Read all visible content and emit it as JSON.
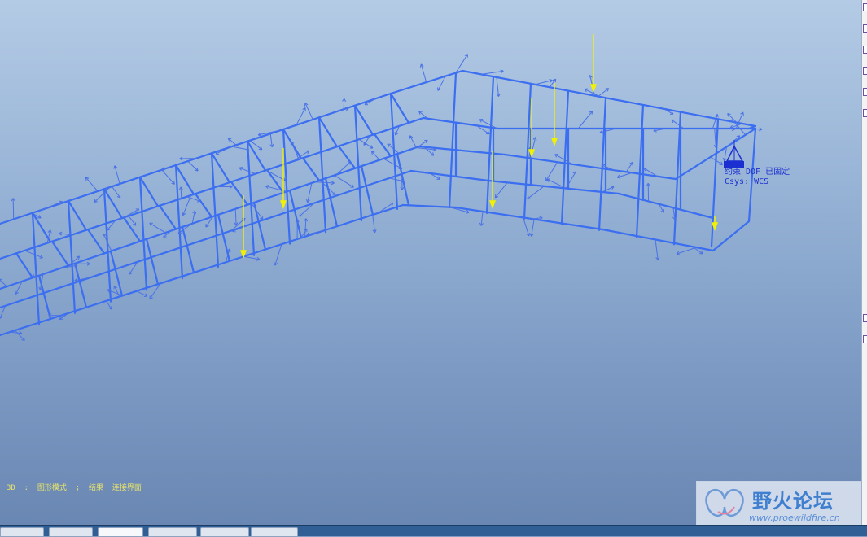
{
  "viewport": {
    "background_top": "#b4cbe5",
    "background_bottom": "#6a87b3",
    "frame_color": "#3b6ef0",
    "load_color": "#f2f200"
  },
  "constraint": {
    "line1": "约束 DOF 已固定",
    "line2": "Csys: WCS",
    "color": "#1c2fd0"
  },
  "status_bar": {
    "text": "3D  :  图形模式  ;  结果  连接界面"
  },
  "watermark": {
    "title": "野火论坛",
    "url": "www.proewildfire.cn"
  }
}
